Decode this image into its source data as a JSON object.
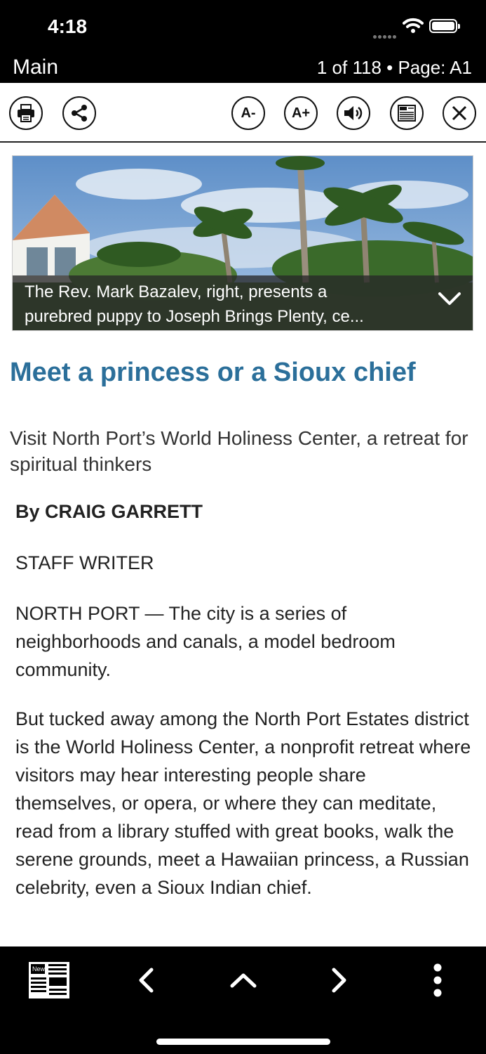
{
  "status_bar": {
    "time": "4:18"
  },
  "nav": {
    "title": "Main",
    "page_info": "1 of 118 • Page: A1"
  },
  "toolbar": {
    "print": "print-icon",
    "share": "share-icon",
    "font_decrease": "A-",
    "font_increase": "A+",
    "audio": "speaker-icon",
    "news": "newspaper-icon",
    "close": "close-icon"
  },
  "article": {
    "photo_caption": "The Rev. Mark Bazalev, right, presents a\npurebred puppy to Joseph Brings Plenty, ce...",
    "headline": "Meet a princess or a Sioux chief",
    "dek": "Visit North Port’s World Holiness Center, a retreat for spiritual thinkers",
    "byline": "By CRAIG GARRETT",
    "role": "STAFF WRITER",
    "paragraphs": [
      "NORTH PORT — The city is a series of neighborhoods and canals, a model bedroom community.",
      "But tucked away among the North Port Estates district is the World Holiness Center, a nonprofit retreat where visitors may hear interesting people share themselves, or opera, or where they can meditate, read from a library stuffed with great books, walk the serene grounds, meet a Hawaiian princess, a Russian celebrity, even a Sioux Indian chief."
    ]
  },
  "bottom_nav": {
    "sections": "newspaper-icon",
    "previous": "chevron-left-icon",
    "up": "chevron-up-icon",
    "next": "chevron-right-icon",
    "more": "more-vertical-icon"
  },
  "colors": {
    "headline": "#2b6f9a",
    "bars": "#000000"
  }
}
